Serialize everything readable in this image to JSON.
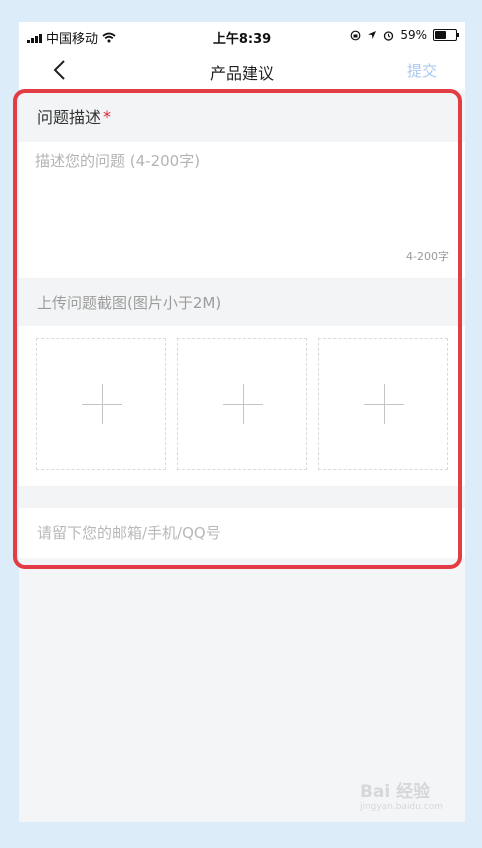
{
  "status_bar": {
    "carrier": "中国移动",
    "time": "上午8:39",
    "battery": "59%",
    "battery_level": 0.59
  },
  "nav": {
    "title": "产品建议",
    "submit_label": "提交"
  },
  "description": {
    "label": "问题描述",
    "required_mark": "*",
    "placeholder": "描述您的问题 (4-200字)",
    "counter": "4-200字"
  },
  "upload": {
    "label": "上传问题截图(图片小于2M)",
    "slots": [
      "add-image",
      "add-image",
      "add-image"
    ]
  },
  "contact": {
    "placeholder": "请留下您的邮箱/手机/QQ号"
  },
  "watermark": {
    "text": "Bai 经验",
    "subtext": "jingyan.baidu.com"
  },
  "colors": {
    "highlight": "#e23c44",
    "submit": "#a9c7ee",
    "required": "#e0262e"
  }
}
